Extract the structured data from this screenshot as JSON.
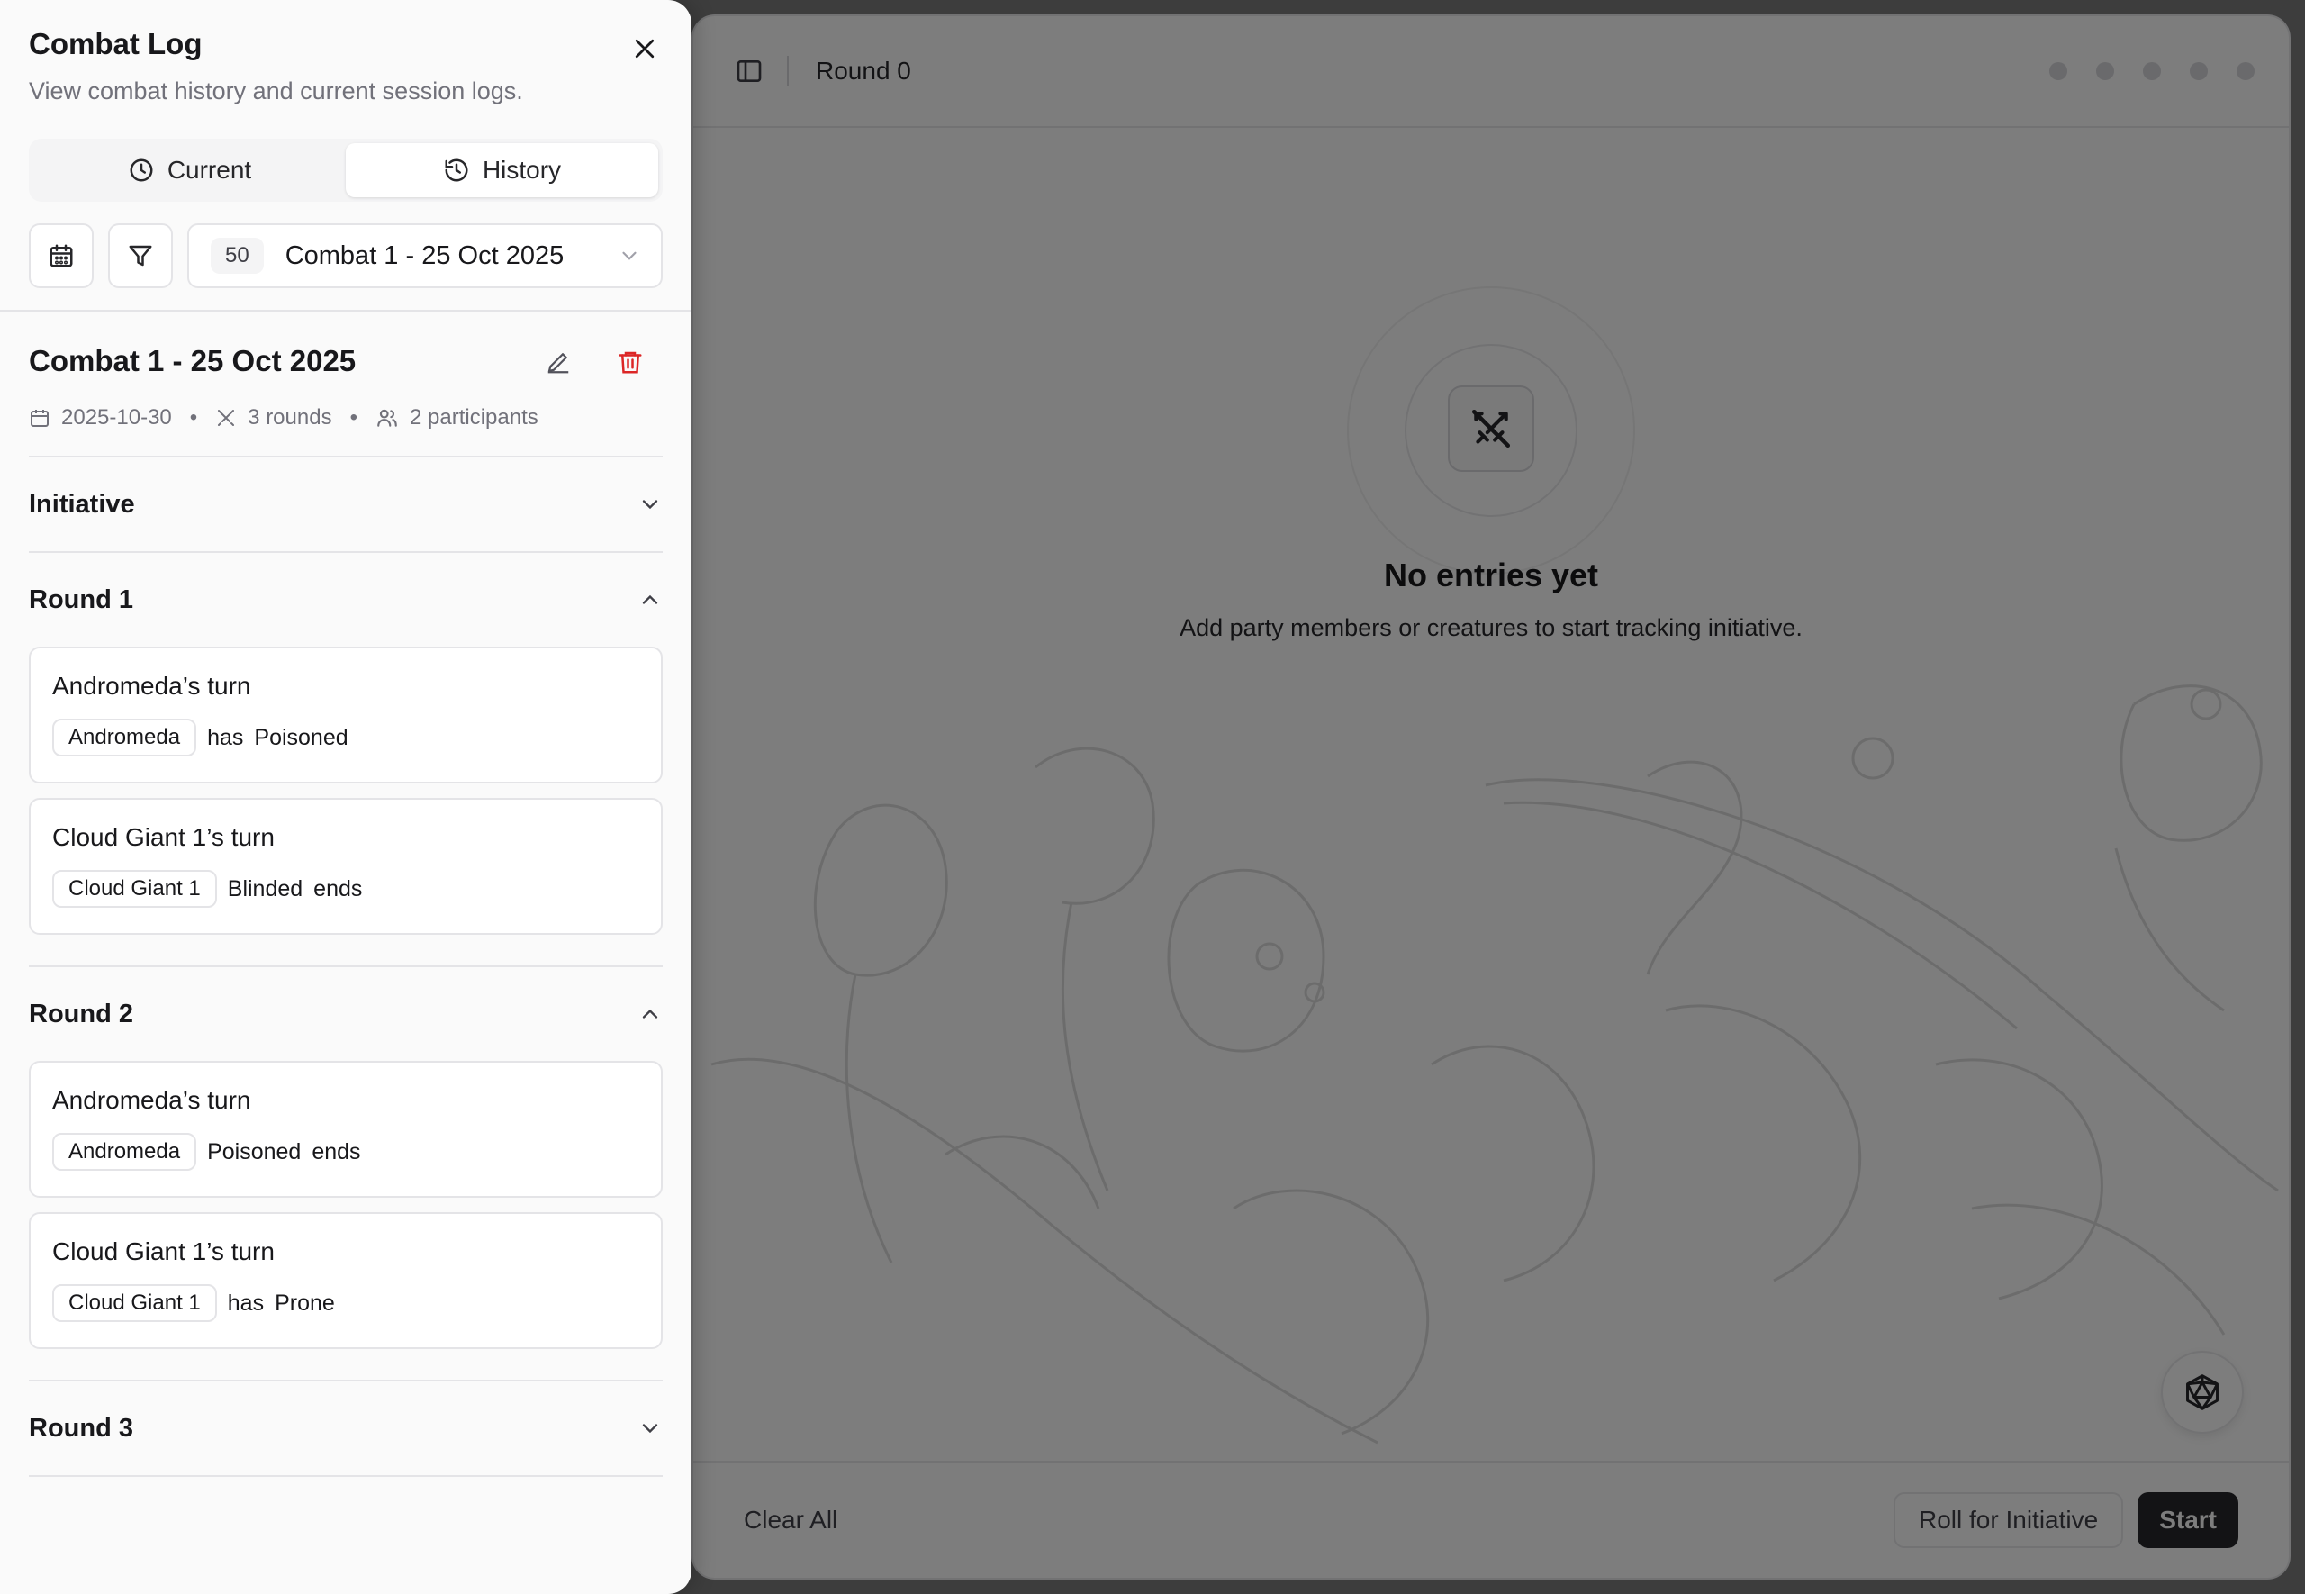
{
  "app": {
    "round_title": "Round 0",
    "empty_title": "No entries yet",
    "empty_subtitle": "Add party members or creatures to start tracking initiative.",
    "clear_all": "Clear All",
    "roll_initiative": "Roll for Initiative",
    "start": "Start"
  },
  "panel": {
    "title": "Combat Log",
    "description": "View combat history and current session logs.",
    "tabs": [
      {
        "label": "Current",
        "icon": "clock-icon",
        "active": false
      },
      {
        "label": "History",
        "icon": "history-icon",
        "active": true
      }
    ],
    "select": {
      "count": "50",
      "value": "Combat 1 - 25 Oct 2025"
    },
    "log": {
      "title": "Combat 1 - 25 Oct 2025",
      "date": "2025-10-30",
      "rounds": "3 rounds",
      "participants": "2 participants",
      "bullet": "•"
    },
    "sections": [
      {
        "title": "Initiative",
        "expanded": false
      },
      {
        "title": "Round 1",
        "expanded": true,
        "turns": [
          {
            "title": "Andromeda’s turn",
            "chip": "Andromeda",
            "prefix": "has",
            "condition": "Poisoned",
            "suffix": ""
          },
          {
            "title": "Cloud Giant 1’s turn",
            "chip": "Cloud Giant 1",
            "prefix": "",
            "condition": "Blinded",
            "suffix": "ends"
          }
        ]
      },
      {
        "title": "Round 2",
        "expanded": true,
        "turns": [
          {
            "title": "Andromeda’s turn",
            "chip": "Andromeda",
            "prefix": "",
            "condition": "Poisoned",
            "suffix": "ends"
          },
          {
            "title": "Cloud Giant 1’s turn",
            "chip": "Cloud Giant 1",
            "prefix": "has",
            "condition": "Prone",
            "suffix": ""
          }
        ]
      },
      {
        "title": "Round 3",
        "expanded": false
      }
    ]
  },
  "colors": {
    "danger": "#dc2626",
    "accent": "#27272a",
    "muted": "#71717a"
  }
}
